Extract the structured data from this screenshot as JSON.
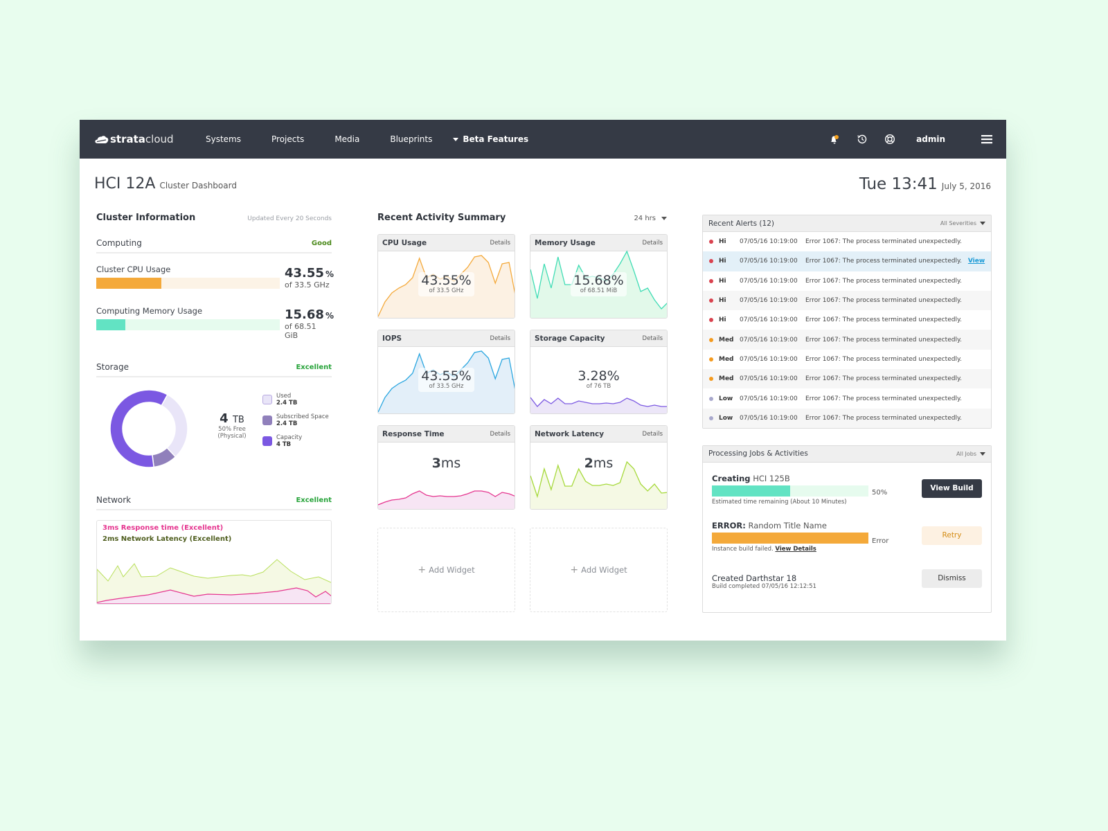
{
  "nav": {
    "brand_bold": "strata",
    "brand_light": "cloud",
    "items": [
      "Systems",
      "Projects",
      "Media",
      "Blueprints"
    ],
    "beta_label": "Beta Features",
    "user": "admin",
    "icons": [
      "bell-icon",
      "history-icon",
      "help-lifebuoy-icon",
      "hamburger-menu-icon"
    ],
    "notification_dot_color": "#f6a21e"
  },
  "header": {
    "title": "HCI 12A",
    "subtitle": "Cluster Dashboard",
    "time": "Tue 13:41",
    "date": "July 5, 2016"
  },
  "cluster": {
    "title": "Cluster Information",
    "update_note": "Updated Every 20 Seconds",
    "computing": {
      "label": "Computing",
      "status": "Good",
      "cpu": {
        "label": "Cluster CPU Usage",
        "value": "43.55",
        "unit": "%",
        "of": "of 33.5 GHz",
        "fraction": 0.3555,
        "color": "#f4a93a",
        "track": "#fcf3e6"
      },
      "memory": {
        "label": "Computing Memory Usage",
        "value": "15.68",
        "unit": "%",
        "of": "of 68.51 GiB",
        "fraction": 0.1568,
        "color": "#62e3c3",
        "track": "#e6fbee"
      }
    },
    "storage": {
      "label": "Storage",
      "status": "Excellent",
      "total_value": "4",
      "total_unit": "TB",
      "free_line1": "50% Free",
      "free_line2": "(Physical)",
      "segments": [
        {
          "name": "Used",
          "fraction": 0.3,
          "color": "#e9e5f8"
        },
        {
          "name": "Subscribed Space",
          "fraction": 0.1,
          "color": "#9080bb"
        },
        {
          "name": "Capacity",
          "fraction": 0.6,
          "color": "#7b58e2"
        }
      ],
      "legend": [
        {
          "label": "Used",
          "value": "2.4 TB",
          "color": "#e9e5f8"
        },
        {
          "label": "Subscribed Space",
          "value": "2.4 TB",
          "color": "#9080bb"
        },
        {
          "label": "Capacity",
          "value": "4 TB",
          "color": "#7b58e2"
        }
      ]
    },
    "network": {
      "label": "Network",
      "status": "Excellent",
      "line1": "3ms Response time (Excellent)",
      "line2": "2ms Network Latency (Excellent)"
    }
  },
  "activity": {
    "title": "Recent Activity Summary",
    "range": "24 hrs",
    "details_label": "Details",
    "widgets": [
      {
        "title": "CPU Usage",
        "value": "43.55%",
        "of": "of 33.5 GHz",
        "color": "#f4a93a",
        "fill": "#fcf1e3"
      },
      {
        "title": "Memory Usage",
        "value": "15.68%",
        "of": "of 68.51 MiB",
        "color": "#3fdcb4",
        "fill": "#e2f9ea"
      },
      {
        "title": "IOPS",
        "value": "43.55%",
        "of": "of 33.5 GHz",
        "color": "#2aa6e0",
        "fill": "#e3eff9"
      },
      {
        "title": "Storage Capacity",
        "value": "3.28%",
        "of": "of 76 TB",
        "color": "#7b58e2",
        "fill": "#ece6f8"
      },
      {
        "title": "Response Time",
        "value_bold": "3",
        "value_unit": "ms",
        "color": "#e5358f",
        "fill": "#f7e5f4"
      },
      {
        "title": "Network Latency",
        "value_bold": "2",
        "value_unit": "ms",
        "color": "#a6d93b",
        "fill": "#f5f9e4"
      }
    ],
    "add_widget_label": "Add Widget"
  },
  "alerts": {
    "title": "Recent Alerts (12)",
    "filter": "All Severities",
    "view_label": "View",
    "rows": [
      {
        "sev": "Hi",
        "color": "#d9424f",
        "ts": "07/05/16 10:19:00",
        "msg": "Error 1067: The process terminated unexpectedly."
      },
      {
        "sev": "Hi",
        "color": "#d9424f",
        "ts": "07/05/16 10:19:00",
        "msg": "Error 1067: The process terminated unexpectedly.",
        "highlight": true
      },
      {
        "sev": "Hi",
        "color": "#d9424f",
        "ts": "07/05/16 10:19:00",
        "msg": "Error 1067: The process terminated unexpectedly."
      },
      {
        "sev": "Hi",
        "color": "#d9424f",
        "ts": "07/05/16 10:19:00",
        "msg": "Error 1067: The process terminated unexpectedly."
      },
      {
        "sev": "Hi",
        "color": "#d9424f",
        "ts": "07/05/16 10:19:00",
        "msg": "Error 1067: The process terminated unexpectedly."
      },
      {
        "sev": "Med",
        "color": "#f49a1e",
        "ts": "07/05/16 10:19:00",
        "msg": "Error 1067: The process terminated unexpectedly."
      },
      {
        "sev": "Med",
        "color": "#f49a1e",
        "ts": "07/05/16 10:19:00",
        "msg": "Error 1067: The process terminated unexpectedly."
      },
      {
        "sev": "Med",
        "color": "#f49a1e",
        "ts": "07/05/16 10:19:00",
        "msg": "Error 1067: The process terminated unexpectedly."
      },
      {
        "sev": "Low",
        "color": "#a8a8cc",
        "ts": "07/05/16 10:19:00",
        "msg": "Error 1067: The process terminated unexpectedly."
      },
      {
        "sev": "Low",
        "color": "#a8a8cc",
        "ts": "07/05/16 10:19:00",
        "msg": "Error 1067: The process terminated unexpectedly."
      }
    ]
  },
  "jobs": {
    "title": "Processing Jobs & Activities",
    "filter": "All Jobs",
    "items": [
      {
        "prefix": "Creating",
        "name": "HCI 125B",
        "progress": 0.5,
        "progress_label": "50%",
        "color": "#62e3c3",
        "track": "#e6fbee",
        "sub": "Estimated time remaining (About 10 Minutes)",
        "button": "View Build"
      },
      {
        "prefix": "ERROR:",
        "name": "Random Title Name",
        "progress": 1.0,
        "progress_label": "Error",
        "color": "#f4a93a",
        "track": "#fcf3e6",
        "sub": "Instance build failed.",
        "sub_link": "View Details",
        "button": "Retry"
      },
      {
        "prefix": "",
        "name": "Created Darthstar 18",
        "sub": "Build completed 07/05/16 12:12:51",
        "button": "Dismiss"
      }
    ]
  }
}
